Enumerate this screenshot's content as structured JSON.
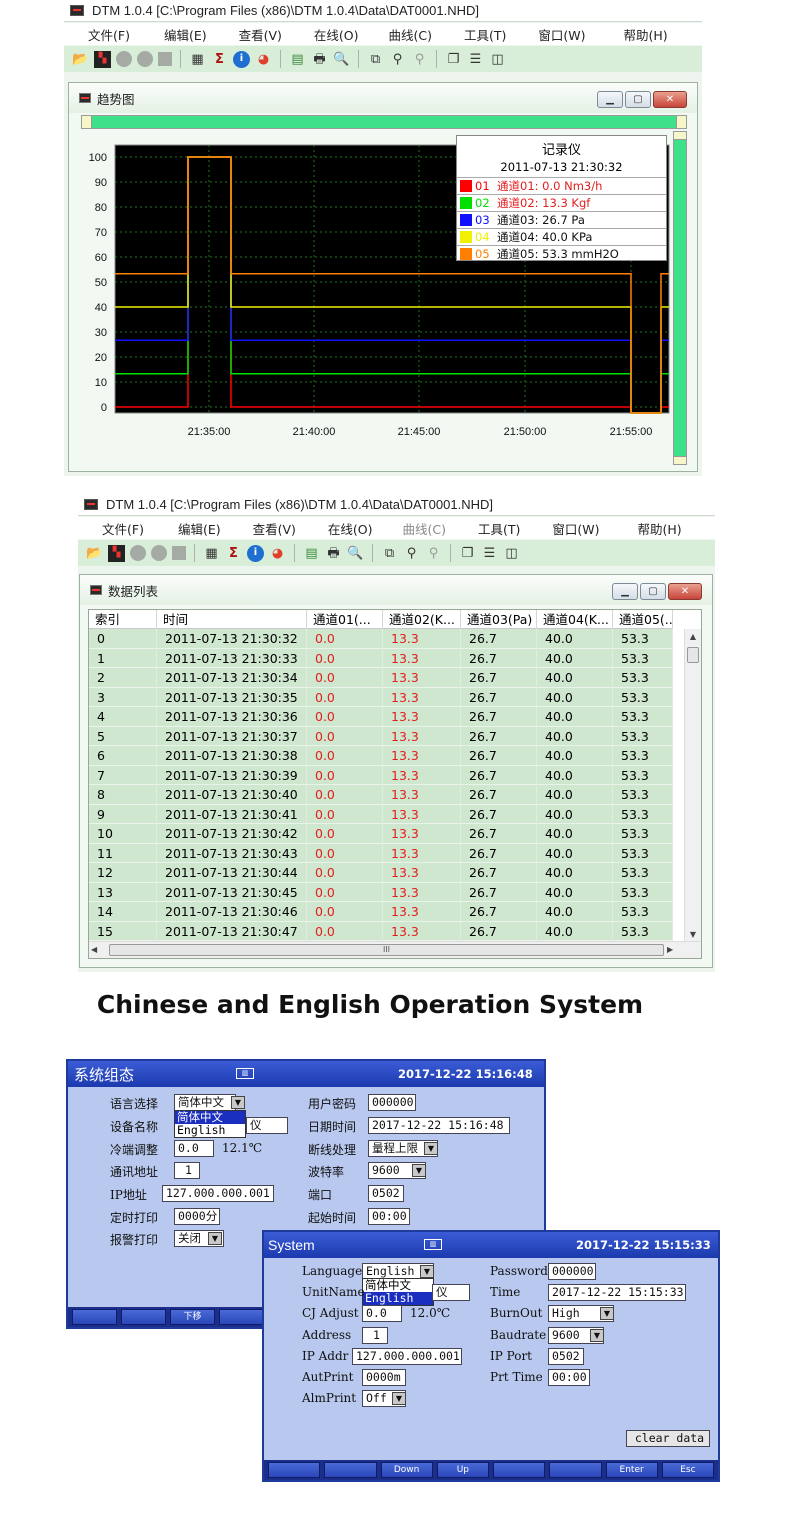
{
  "window1": {
    "title": "DTM 1.0.4 [C:\\Program Files (x86)\\DTM 1.0.4\\Data\\DAT0001.NHD]",
    "menus": [
      "文件(F)",
      "编辑(E)",
      "查看(V)",
      "在线(O)",
      "曲线(C)",
      "工具(T)",
      "窗口(W)",
      "帮助(H)"
    ],
    "child_title": "趋势图"
  },
  "window2": {
    "title": "DTM 1.0.4 [C:\\Program Files (x86)\\DTM 1.0.4\\Data\\DAT0001.NHD]",
    "menus": [
      "文件(F)",
      "编辑(E)",
      "查看(V)",
      "在线(O)",
      "曲线(C)",
      "工具(T)",
      "窗口(W)",
      "帮助(H)"
    ],
    "child_title": "数据列表",
    "columns": [
      "索引",
      "时间",
      "通道01(...",
      "通道02(K...",
      "通道03(Pa)",
      "通道04(K...",
      "通道05(..."
    ],
    "rows": [
      [
        "0",
        "2011-07-13 21:30:32",
        "0.0",
        "13.3",
        "26.7",
        "40.0",
        "53.3"
      ],
      [
        "1",
        "2011-07-13 21:30:33",
        "0.0",
        "13.3",
        "26.7",
        "40.0",
        "53.3"
      ],
      [
        "2",
        "2011-07-13 21:30:34",
        "0.0",
        "13.3",
        "26.7",
        "40.0",
        "53.3"
      ],
      [
        "3",
        "2011-07-13 21:30:35",
        "0.0",
        "13.3",
        "26.7",
        "40.0",
        "53.3"
      ],
      [
        "4",
        "2011-07-13 21:30:36",
        "0.0",
        "13.3",
        "26.7",
        "40.0",
        "53.3"
      ],
      [
        "5",
        "2011-07-13 21:30:37",
        "0.0",
        "13.3",
        "26.7",
        "40.0",
        "53.3"
      ],
      [
        "6",
        "2011-07-13 21:30:38",
        "0.0",
        "13.3",
        "26.7",
        "40.0",
        "53.3"
      ],
      [
        "7",
        "2011-07-13 21:30:39",
        "0.0",
        "13.3",
        "26.7",
        "40.0",
        "53.3"
      ],
      [
        "8",
        "2011-07-13 21:30:40",
        "0.0",
        "13.3",
        "26.7",
        "40.0",
        "53.3"
      ],
      [
        "9",
        "2011-07-13 21:30:41",
        "0.0",
        "13.3",
        "26.7",
        "40.0",
        "53.3"
      ],
      [
        "10",
        "2011-07-13 21:30:42",
        "0.0",
        "13.3",
        "26.7",
        "40.0",
        "53.3"
      ],
      [
        "11",
        "2011-07-13 21:30:43",
        "0.0",
        "13.3",
        "26.7",
        "40.0",
        "53.3"
      ],
      [
        "12",
        "2011-07-13 21:30:44",
        "0.0",
        "13.3",
        "26.7",
        "40.0",
        "53.3"
      ],
      [
        "13",
        "2011-07-13 21:30:45",
        "0.0",
        "13.3",
        "26.7",
        "40.0",
        "53.3"
      ],
      [
        "14",
        "2011-07-13 21:30:46",
        "0.0",
        "13.3",
        "26.7",
        "40.0",
        "53.3"
      ],
      [
        "15",
        "2011-07-13 21:30:47",
        "0.0",
        "13.3",
        "26.7",
        "40.0",
        "53.3"
      ]
    ],
    "hscroll_grip": "III"
  },
  "chart_data": {
    "type": "line",
    "y_ticks": [
      "100",
      "90",
      "80",
      "70",
      "60",
      "50",
      "40",
      "30",
      "20",
      "10",
      "0"
    ],
    "x_ticks": [
      "21:35:00",
      "21:40:00",
      "21:45:00",
      "21:50:00",
      "21:55:00"
    ],
    "ylim": [
      0,
      100
    ],
    "series_colors": [
      "#ff0000",
      "#00e000",
      "#1010ff",
      "#f0f000",
      "#ff8000"
    ],
    "series_levels": [
      0,
      13.3,
      26.7,
      40.0,
      53.3
    ],
    "grid": true
  },
  "legend": {
    "title": "记录仪",
    "datetime": "2011-07-13 21:30:32",
    "rows": [
      {
        "idx": "01",
        "text": "通道01: 0.0 Nm3/h",
        "color": "#ff0000",
        "text_color": "#e21e1e"
      },
      {
        "idx": "02",
        "text": "通道02: 13.3 Kgf",
        "color": "#00e000",
        "text_color": "#e21e1e"
      },
      {
        "idx": "03",
        "text": "通道03: 26.7 Pa",
        "color": "#1010ff",
        "text_color": "#111111"
      },
      {
        "idx": "04",
        "text": "通道04: 40.0 KPa",
        "color": "#f0f000",
        "text_color": "#111111"
      },
      {
        "idx": "05",
        "text": "通道05: 53.3 mmH2O",
        "color": "#ff8000",
        "text_color": "#111111"
      }
    ]
  },
  "caption": "Chinese and English Operation System",
  "device_cn": {
    "title": "系统组态",
    "datetime": "2017-12-22 15:16:48",
    "lang_label": "语言选择",
    "lang_value": "简体中文",
    "lang_options": [
      "简体中文",
      "English"
    ],
    "device_label": "设备名称",
    "device_value_suffix": "仪",
    "cj_label": "冷端调整",
    "cj_value": "0.0",
    "cj_temp": "12.1℃",
    "addr_label": "通讯地址",
    "addr_value": "1",
    "ip_label": "IP地址",
    "ip_value": "127.000.000.001",
    "timeprint_label": "定时打印",
    "timeprint_value": "0000分",
    "alarm_label": "报警打印",
    "alarm_value": "关闭",
    "pwd_label": "用户密码",
    "pwd_value": "000000",
    "time_label": "日期时间",
    "time_value": "2017-12-22 15:16:48",
    "burn_label": "断线处理",
    "burn_value": "量程上限",
    "baud_label": "波特率",
    "baud_value": "9600",
    "port_label": "端口",
    "port_value": "0502",
    "start_label": "起始时间",
    "start_value": "00:00",
    "fkeys": [
      "",
      "",
      "下移",
      ""
    ]
  },
  "device_en": {
    "title": "System",
    "datetime": "2017-12-22 15:15:33",
    "lang_label": "Language",
    "lang_value": "English",
    "lang_options": [
      "简体中文",
      "English"
    ],
    "unit_label": "UnitName",
    "unit_suffix": "仪",
    "cj_label": "CJ Adjust",
    "cj_value": "0.0",
    "cj_temp": "12.0℃",
    "addr_label": "Address",
    "addr_value": "1",
    "ip_label": "IP Addr",
    "ip_value": "127.000.000.001",
    "autprint_label": "AutPrint",
    "autprint_value": "0000m",
    "almprint_label": "AlmPrint",
    "almprint_value": "Off",
    "pwd_label": "Password",
    "pwd_value": "000000",
    "time_label": "Time",
    "time_value": "2017-12-22 15:15:33",
    "burn_label": "BurnOut",
    "burn_value": "High",
    "baud_label": "Baudrate",
    "baud_value": "9600",
    "port_label": "IP Port",
    "port_value": "0502",
    "prt_label": "Prt Time",
    "prt_value": "00:00",
    "clear_label": "clear data",
    "fkeys": [
      "",
      "",
      "Down",
      "Up",
      "",
      "",
      "Enter",
      "Esc"
    ]
  }
}
